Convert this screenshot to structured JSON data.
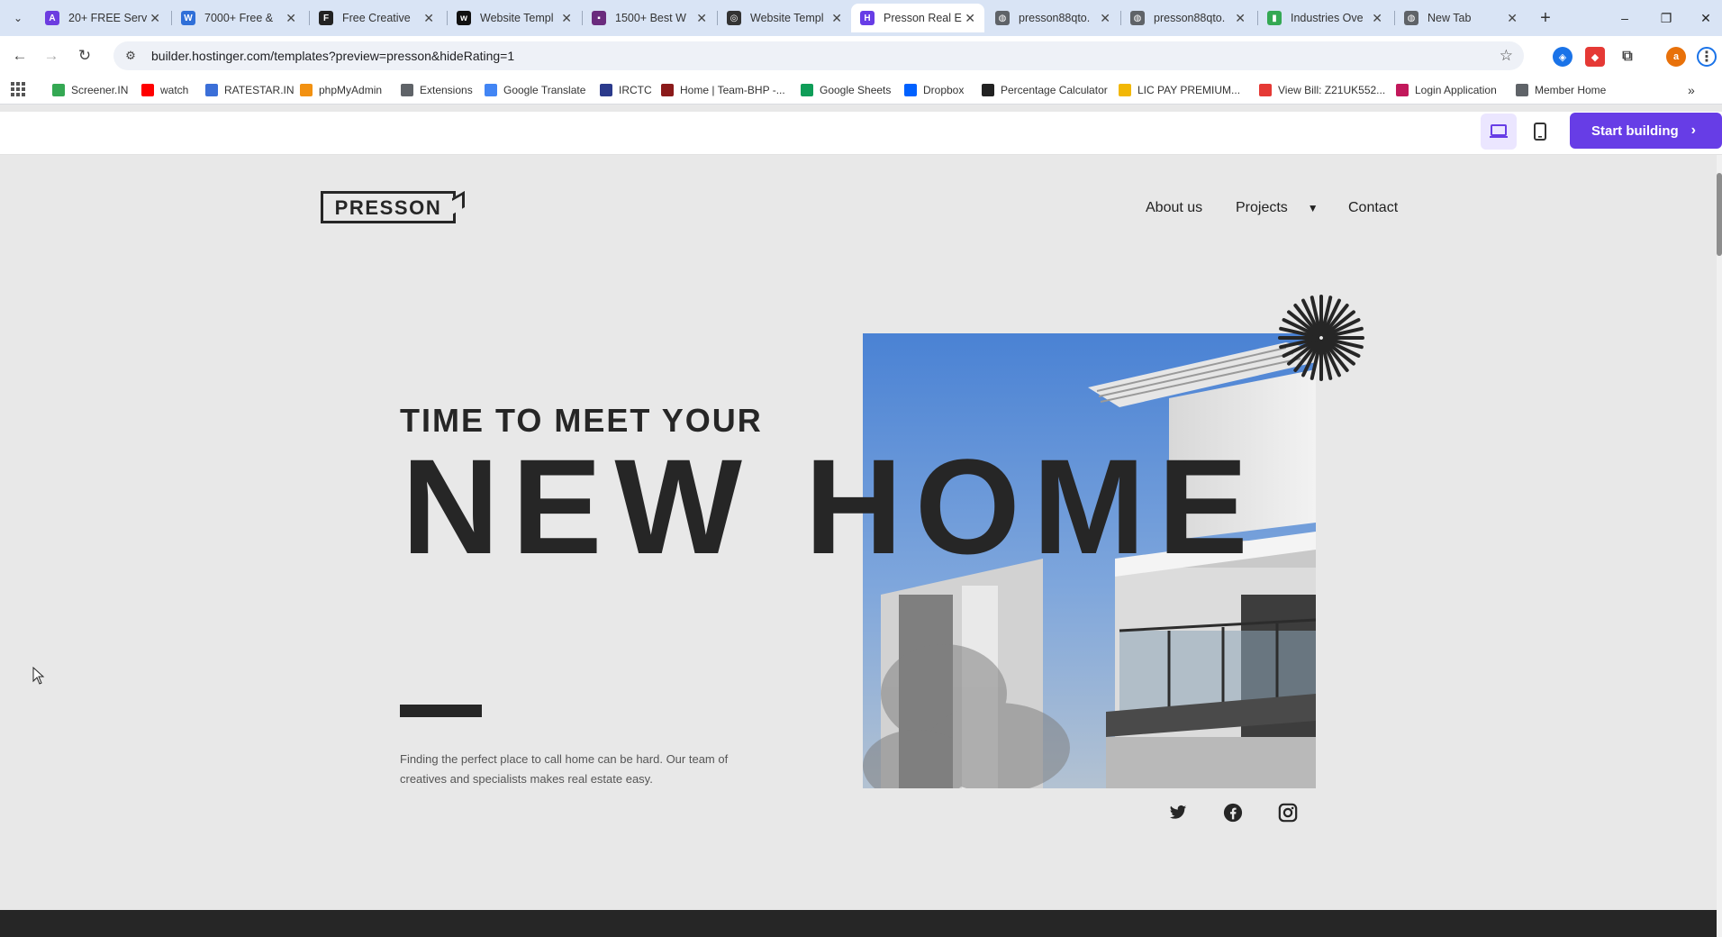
{
  "browser": {
    "tabs": [
      {
        "label": "20+ FREE Serv",
        "color": "#6c3ce0",
        "glyph": "A"
      },
      {
        "label": "7000+ Free &",
        "color": "#2f6fd8",
        "glyph": "W"
      },
      {
        "label": "Free Creative",
        "color": "#222222",
        "glyph": "F"
      },
      {
        "label": "Website Templ",
        "color": "#111111",
        "glyph": "w"
      },
      {
        "label": "1500+ Best W",
        "color": "#6a2b7d",
        "glyph": "▪"
      },
      {
        "label": "Website Templ",
        "color": "#333333",
        "glyph": "◎"
      },
      {
        "label": "Presson Real E",
        "color": "#673de6",
        "glyph": "H"
      },
      {
        "label": "presson88qto.",
        "color": "#5f6368",
        "glyph": "◍"
      },
      {
        "label": "presson88qto.",
        "color": "#5f6368",
        "glyph": "◍"
      },
      {
        "label": "Industries Ove",
        "color": "#34a853",
        "glyph": "▮"
      },
      {
        "label": "New Tab",
        "color": "#5f6368",
        "glyph": "◍"
      }
    ],
    "active_tab_index": 6,
    "url": "builder.hostinger.com/templates?preview=presson&hideRating=1",
    "profile_initial": "a",
    "bookmarks": [
      {
        "label": "Screener.IN",
        "color": "#34a853"
      },
      {
        "label": "watch",
        "color": "#ff0000"
      },
      {
        "label": "RATESTAR.IN",
        "color": "#3b6fd8"
      },
      {
        "label": "phpMyAdmin",
        "color": "#f29111"
      },
      {
        "label": "Extensions",
        "color": "#5f6368"
      },
      {
        "label": "Google Translate",
        "color": "#4285f4"
      },
      {
        "label": "IRCTC",
        "color": "#2b3a8c"
      },
      {
        "label": "Home | Team-BHP -...",
        "color": "#8b1a1a"
      },
      {
        "label": "Google Sheets",
        "color": "#0f9d58"
      },
      {
        "label": "Dropbox",
        "color": "#0061ff"
      },
      {
        "label": "Percentage Calculator",
        "color": "#222222"
      },
      {
        "label": "LIC PAY PREMIUM...",
        "color": "#f2b705"
      },
      {
        "label": "View Bill: Z21UK552...",
        "color": "#e53935"
      },
      {
        "label": "Login Application",
        "color": "#c2185b"
      },
      {
        "label": "Member Home",
        "color": "#5f6368"
      }
    ]
  },
  "builder": {
    "start_label": "Start building"
  },
  "site": {
    "logo_text": "PRESSON",
    "nav": {
      "about": "About us",
      "projects": "Projects",
      "contact": "Contact"
    },
    "eyebrow": "TIME TO MEET YOUR",
    "headline": "NEW HOME",
    "blurb": "Finding the perfect place to call home can be hard. Our team of creatives and specialists makes real estate easy."
  },
  "colors": {
    "accent": "#673de6",
    "ink": "#262626",
    "page_bg": "#e8e8e8"
  }
}
